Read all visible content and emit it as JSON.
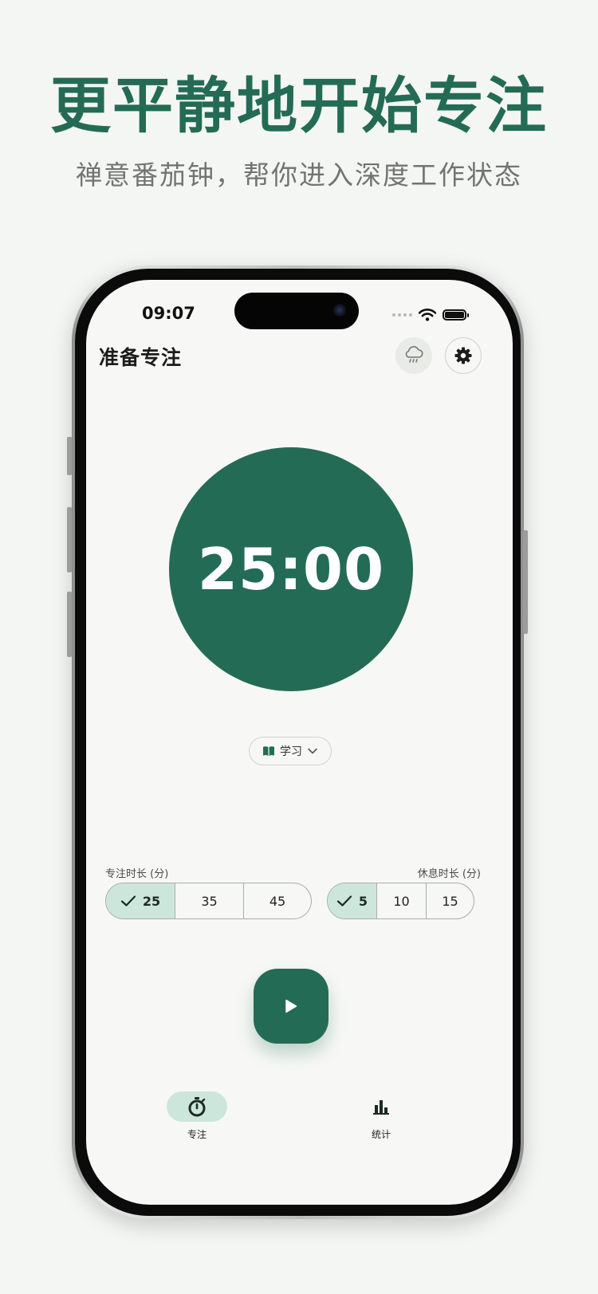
{
  "promo": {
    "headline": "更平静地开始专注",
    "subline": "禅意番茄钟，帮你进入深度工作状态"
  },
  "status_bar": {
    "time": "09:07"
  },
  "header": {
    "title": "准备专注",
    "weather_icon": "rain-cloud-icon",
    "settings_icon": "gear-icon"
  },
  "timer": {
    "display": "25:00"
  },
  "category": {
    "icon": "book-icon",
    "label": "学习"
  },
  "focus_duration": {
    "label": "专注时长 (分)",
    "options": [
      "25",
      "35",
      "45"
    ],
    "selected": "25"
  },
  "break_duration": {
    "label": "休息时长 (分)",
    "options": [
      "5",
      "10",
      "15"
    ],
    "selected": "5"
  },
  "controls": {
    "play_icon": "play-icon"
  },
  "tabs": [
    {
      "label": "专注",
      "icon": "stopwatch-icon",
      "active": true
    },
    {
      "label": "统计",
      "icon": "bar-chart-icon",
      "active": false
    }
  ],
  "colors": {
    "brand": "#246b55",
    "selected_bg": "#cde6dc",
    "background": "#f4f6f3"
  }
}
